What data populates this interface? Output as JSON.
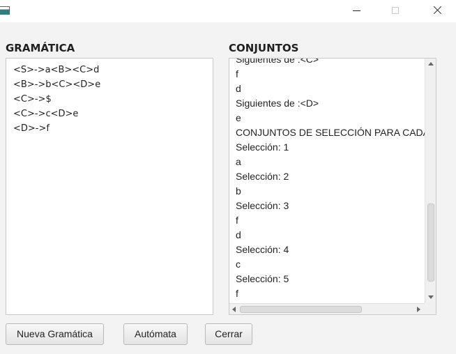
{
  "window": {
    "title": "",
    "controls": [
      "minimize",
      "maximize",
      "close"
    ]
  },
  "grammar": {
    "heading": "GRAMÁTICA",
    "lines": [
      "<S>->a<B><C>d",
      "<B>->b<C><D>e",
      "<C>->$",
      "<C>->c<D>e",
      "<D>->f"
    ]
  },
  "sets": {
    "heading": "CONJUNTOS",
    "lines": [
      "Siguientes de :<C>",
      "f",
      "d",
      "Siguientes de :<D>",
      "e",
      "CONJUNTOS DE SELECCIÓN PARA CADA",
      "Selección: 1",
      "a",
      "Selección: 2",
      "b",
      "Selección: 3",
      "f",
      "d",
      "Selección: 4",
      "c",
      "Selección: 5",
      "f"
    ]
  },
  "buttons": {
    "new_grammar": "Nueva Gramática",
    "automaton": "Autómata",
    "close": "Cerrar"
  },
  "icons": {
    "app": "app-icon",
    "minimize": "minimize-icon",
    "maximize": "maximize-icon",
    "close": "close-icon"
  }
}
